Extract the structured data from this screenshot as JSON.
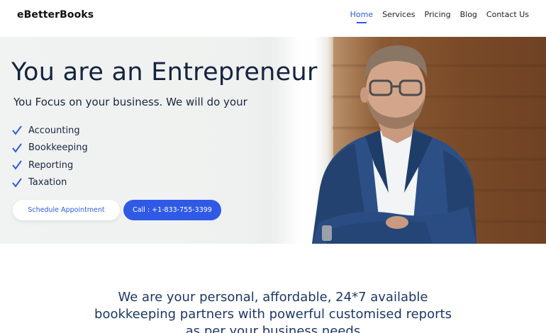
{
  "header": {
    "logo": "eBetterBooks",
    "nav": [
      "Home",
      "Services",
      "Pricing",
      "Blog",
      "Contact Us"
    ],
    "active_nav": "Home"
  },
  "hero": {
    "title": "You are an Entrepreneur",
    "subtitle": "You Focus on your business. We will do your",
    "checklist": [
      "Accounting",
      "Bookkeeping",
      "Reporting",
      "Taxation"
    ],
    "buttons": {
      "appointment": "Schedule Appointment",
      "call": "Call : +1-833-755-3399"
    }
  },
  "intro": {
    "lines": [
      "We are your personal, affordable, 24*7 available",
      "bookkeeping partners with powerful customised reports",
      "as per your business needs"
    ]
  },
  "colors": {
    "accent": "#2d5be3",
    "heading": "#15233f",
    "intro_text": "#1d3766"
  },
  "icons": {
    "check": "check-icon"
  }
}
